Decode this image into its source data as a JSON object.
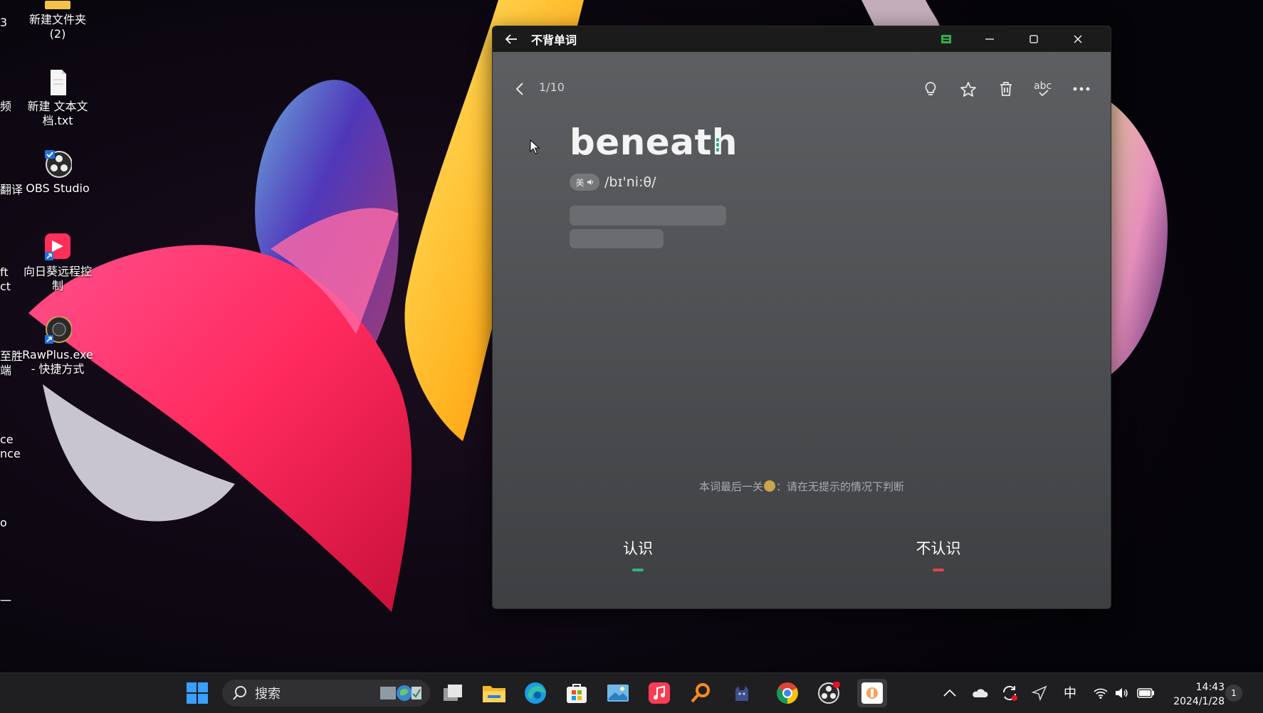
{
  "desktop": {
    "icons": [
      {
        "label": "新建文件夹\n(2)",
        "icon": "folder-icon"
      },
      {
        "label": "新建 文本文\n档.txt",
        "icon": "text-file-icon"
      },
      {
        "label": "OBS Studio",
        "icon": "obs-studio-icon"
      },
      {
        "label": "向日葵远程控\n制",
        "icon": "sunlogin-icon"
      },
      {
        "label": "RawPlus.exe\n- 快捷方式",
        "icon": "rawplus-icon"
      }
    ],
    "left_partial": [
      "3",
      "频",
      "翻译",
      "ft\nct",
      "至胜\n端",
      "ce\nnce",
      "o",
      "一"
    ]
  },
  "window": {
    "title": "不背单词",
    "counter": "1/10",
    "word": "beneath",
    "accent_label": "美",
    "phonetic": "/bɪ'ni:θ/",
    "hint_before": "本词最后一关",
    "hint_after": "：请在无提示的情况下判断",
    "know_label": "认识",
    "dont_know_label": "不认识",
    "colors": {
      "know": "#2fb37c",
      "dont_know": "#e0444e"
    }
  },
  "taskbar": {
    "search_placeholder": "搜索",
    "ime_label": "中",
    "time": "14:43",
    "date": "2024/1/28",
    "notification_count": "1"
  }
}
